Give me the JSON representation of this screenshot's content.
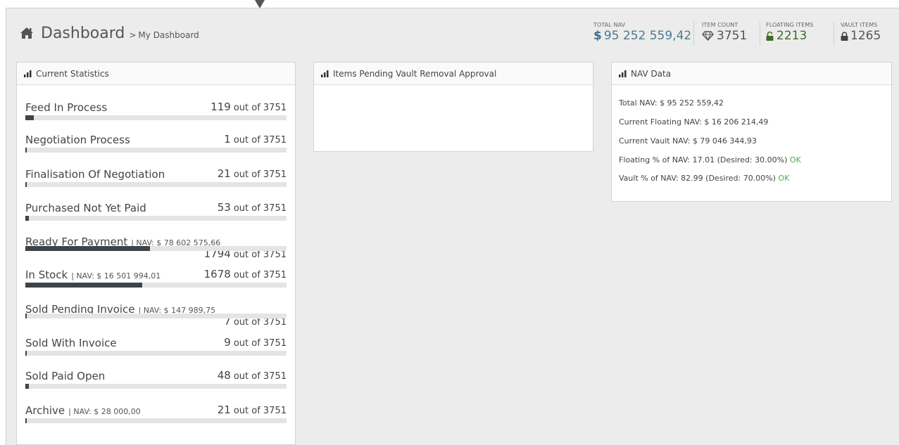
{
  "breadcrumb": {
    "title": "Dashboard",
    "separator": ">",
    "subtitle": "My Dashboard"
  },
  "header_stats": {
    "total_nav": {
      "label": "TOTAL NAV",
      "currency": "$",
      "value": "95 252 559,42"
    },
    "item_count": {
      "label": "ITEM COUNT",
      "value": "3751",
      "icon": "gem-icon"
    },
    "floating_items": {
      "label": "FLOATING ITEMS",
      "value": "2213",
      "icon": "unlock-icon"
    },
    "vault_items": {
      "label": "VAULT ITEMS",
      "value": "1265",
      "icon": "lock-icon"
    }
  },
  "current_statistics": {
    "title": "Current Statistics",
    "rows": [
      {
        "name": "Feed In Process",
        "nav": "",
        "count": "119",
        "of": "out of 3751",
        "fraction": 0.032
      },
      {
        "name": "Negotiation Process",
        "nav": "",
        "count": "1",
        "of": "out of 3751",
        "fraction": 0.0003
      },
      {
        "name": "Finalisation Of Negotiation",
        "nav": "",
        "count": "21",
        "of": "out of 3751",
        "fraction": 0.0056
      },
      {
        "name": "Purchased Not Yet Paid",
        "nav": "",
        "count": "53",
        "of": "out of 3751",
        "fraction": 0.014
      },
      {
        "name": "Ready For Payment",
        "nav": "| NAV: $ 78 602 575,66",
        "count": "1794",
        "of": "out of 3751",
        "fraction": 0.478
      },
      {
        "name": "In Stock",
        "nav": "| NAV: $ 16 501 994,01",
        "count": "1678",
        "of": "out of 3751",
        "fraction": 0.447
      },
      {
        "name": "Sold Pending Invoice",
        "nav": "| NAV: $ 147 989,75",
        "count": "7",
        "of": "out of 3751",
        "fraction": 0.0019
      },
      {
        "name": "Sold With Invoice",
        "nav": "",
        "count": "9",
        "of": "out of 3751",
        "fraction": 0.0024
      },
      {
        "name": "Sold Paid Open",
        "nav": "",
        "count": "48",
        "of": "out of 3751",
        "fraction": 0.0128
      },
      {
        "name": "Archive",
        "nav": "| NAV: $ 28 000,00",
        "count": "21",
        "of": "out of 3751",
        "fraction": 0.0056
      }
    ]
  },
  "pending_vault": {
    "title": "Items Pending Vault Removal Approval"
  },
  "nav_data": {
    "title": "NAV Data",
    "total": "Total NAV: $ 95 252 559,42",
    "floating": "Current Floating NAV: $ 16 206 214,49",
    "vault": "Current Vault NAV: $ 79 046 344,93",
    "floating_pct": "Floating % of NAV: 17.01 (Desired: 30.00%)",
    "floating_status": "OK",
    "vault_pct": "Vault % of NAV: 82.99 (Desired: 70.00%)",
    "vault_status": "OK"
  },
  "colors": {
    "accent": "#4a7b93",
    "bar": "#3d4349",
    "ok": "#5aa55a",
    "floating": "#3e6b27"
  }
}
